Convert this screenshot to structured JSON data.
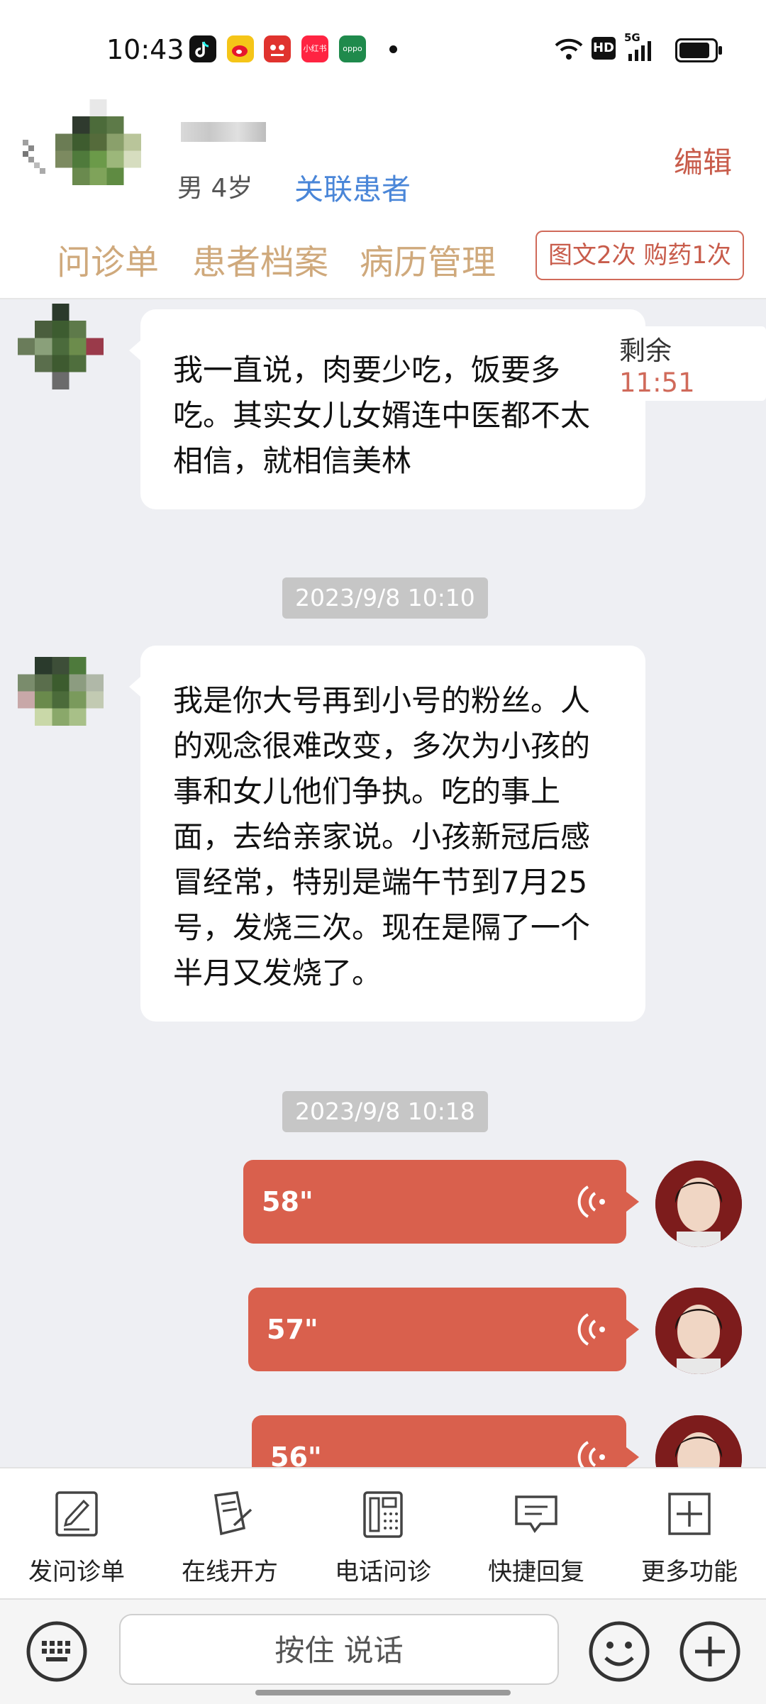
{
  "status_bar": {
    "time": "10:43",
    "apps": [
      "tiktok-icon",
      "weibo-icon",
      "tmall-icon",
      "xiaohongshu-icon",
      "oppo-icon"
    ],
    "app_labels": {
      "xiaohongshu": "小红书",
      "oppo": "oppo"
    },
    "indicators": [
      "wifi-icon",
      "hd-icon",
      "5g-signal-icon",
      "battery-icon"
    ],
    "hd": "HD",
    "network": "5G"
  },
  "header": {
    "patient_info": "男 4岁",
    "link_patient": "关联患者",
    "edit": "编辑",
    "tabs": [
      "问诊单",
      "患者档案",
      "病历管理"
    ],
    "usage_badge": "图文2次 购药1次"
  },
  "chat": {
    "remaining_label": "剩余",
    "remaining_time": "11:51",
    "messages": [
      {
        "text": "我一直说，肉要少吃，饭要多吃。其实女儿女婿连中医都不太相信，就相信美林"
      },
      {
        "text": "我是你大号再到小号的粉丝。人的观念很难改变，多次为小孩的事和女儿他们争执。吃的事上面，去给亲家说。小孩新冠后感冒经常，特别是端午节到7月25号，发烧三次。现在是隔了一个半月又发烧了。"
      }
    ],
    "timestamps": [
      "2023/9/8 10:10",
      "2023/9/8 10:18"
    ],
    "voice_messages": [
      {
        "duration": "58\""
      },
      {
        "duration": "57\""
      },
      {
        "duration": "56\""
      }
    ]
  },
  "toolbar": {
    "items": [
      {
        "label": "发问诊单",
        "icon": "form-edit-icon"
      },
      {
        "label": "在线开方",
        "icon": "prescription-icon"
      },
      {
        "label": "电话问诊",
        "icon": "phone-icon"
      },
      {
        "label": "快捷回复",
        "icon": "quick-reply-icon"
      },
      {
        "label": "更多功能",
        "icon": "plus-box-icon"
      }
    ]
  },
  "input_bar": {
    "hold_to_talk": "按住 说话"
  },
  "colors": {
    "accent": "#d9604d",
    "tab_text": "#cfa97c",
    "link": "#4a86d8",
    "background": "#eeeff3"
  }
}
